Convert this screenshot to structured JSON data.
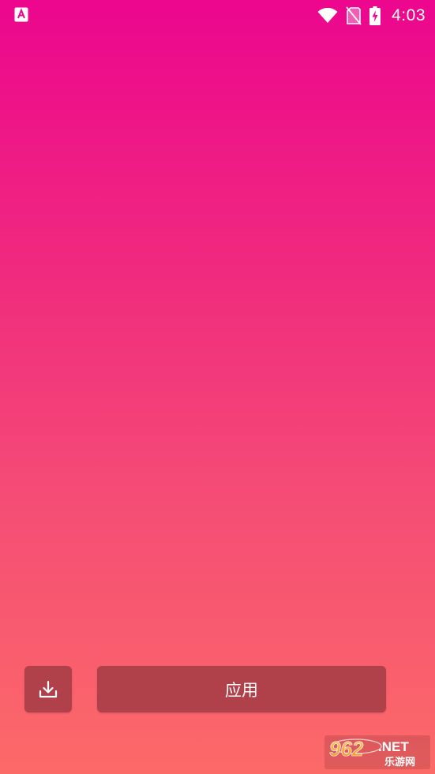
{
  "status_bar": {
    "app_icon": "android-app-icon",
    "wifi_icon": "wifi-icon",
    "sim_icon": "no-sim-icon",
    "battery_icon": "battery-charging-icon",
    "time": "4:03"
  },
  "background": {
    "gradient_top": "#ec068e",
    "gradient_bottom": "#fc6a68"
  },
  "controls": {
    "download_icon": "download-icon",
    "apply_label": "应用",
    "button_color": "#b0404a"
  },
  "watermark": {
    "brand_top": "962.NET",
    "brand_bottom": "乐游网"
  }
}
